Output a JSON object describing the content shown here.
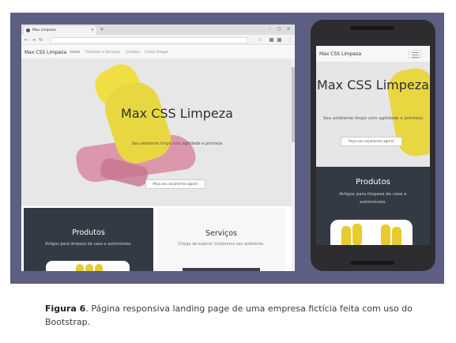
{
  "browser": {
    "tab_title": "Max Limpeza",
    "tab_close": "×",
    "new_tab": "+",
    "win_minimize": "–",
    "win_maximize": "□",
    "win_close": "×"
  },
  "site": {
    "brand": "Max CSS Limpeza",
    "nav": [
      "Início",
      "Produtos e Serviços",
      "Contato",
      "Como chegar"
    ],
    "hero": {
      "title": "Max CSS Limpeza",
      "subtitle": "Seu ambiente limpo com agilidade e presteza",
      "cta": "Peça seu orçamento agora!"
    },
    "cards": [
      {
        "title": "Produtos",
        "subtitle": "Artigos para limpeza de casa e automóveis."
      },
      {
        "title": "Serviços",
        "subtitle": "Chega de sujeira! Limpamos seu ambiente."
      }
    ]
  },
  "mobile": {
    "brand": "Max CSS Limpeza",
    "hero": {
      "title": "Max CSS Limpeza",
      "subtitle": "Seu ambiente limpo com agilidade e presteza",
      "cta": "Peça seu orçamento agora!"
    },
    "card": {
      "title": "Produtos",
      "subtitle": "Artigos para limpeza de casa e automóveis."
    }
  },
  "caption": {
    "label": "Figura 6",
    "text": ". Página responsiva landing page de uma empresa fictícia feita com uso do Bootstrap."
  },
  "colors": {
    "frame": "#5d5f82",
    "dark_section": "#343a44",
    "glove": "#e8d740",
    "cloth": "#d98ea4"
  }
}
